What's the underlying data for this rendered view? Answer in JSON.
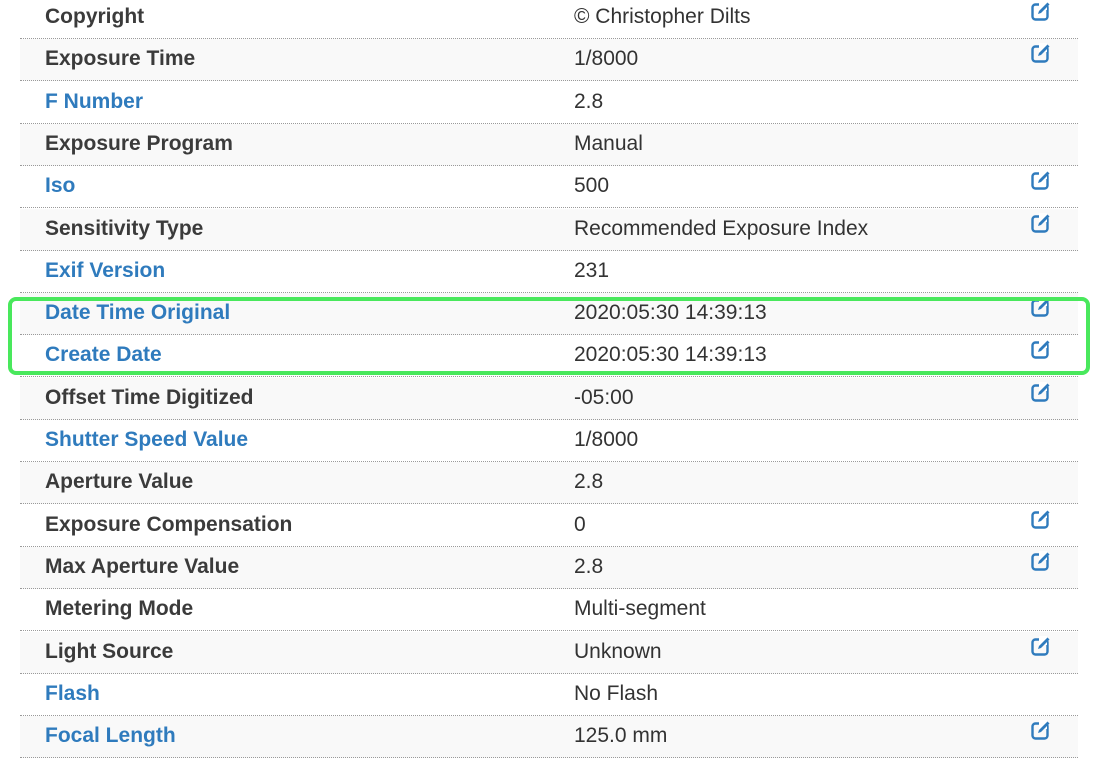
{
  "colors": {
    "link_label": "#2f7bbd",
    "plain_label": "#3b3b3b",
    "value_text": "#333333",
    "edit_icon": "#2f7bbd",
    "highlight_border": "#49e85c"
  },
  "rows": [
    {
      "label": "Copyright",
      "value": "© Christopher Dilts",
      "link": false,
      "editable": true
    },
    {
      "label": "Exposure Time",
      "value": "1/8000",
      "link": false,
      "editable": true
    },
    {
      "label": "F Number",
      "value": "2.8",
      "link": true,
      "editable": false
    },
    {
      "label": "Exposure Program",
      "value": "Manual",
      "link": false,
      "editable": false
    },
    {
      "label": "Iso",
      "value": "500",
      "link": true,
      "editable": true
    },
    {
      "label": "Sensitivity Type",
      "value": "Recommended Exposure Index",
      "link": false,
      "editable": true
    },
    {
      "label": "Exif Version",
      "value": "231",
      "link": true,
      "editable": false
    },
    {
      "label": "Date Time Original",
      "value": "2020:05:30 14:39:13",
      "link": true,
      "editable": true
    },
    {
      "label": "Create Date",
      "value": "2020:05:30 14:39:13",
      "link": true,
      "editable": true
    },
    {
      "label": "Offset Time Digitized",
      "value": "-05:00",
      "link": false,
      "editable": true
    },
    {
      "label": "Shutter Speed Value",
      "value": "1/8000",
      "link": true,
      "editable": false
    },
    {
      "label": "Aperture Value",
      "value": "2.8",
      "link": false,
      "editable": false
    },
    {
      "label": "Exposure Compensation",
      "value": "0",
      "link": false,
      "editable": true
    },
    {
      "label": "Max Aperture Value",
      "value": "2.8",
      "link": false,
      "editable": true
    },
    {
      "label": "Metering Mode",
      "value": "Multi-segment",
      "link": false,
      "editable": false
    },
    {
      "label": "Light Source",
      "value": "Unknown",
      "link": false,
      "editable": true
    },
    {
      "label": "Flash",
      "value": "No Flash",
      "link": true,
      "editable": false
    },
    {
      "label": "Focal Length",
      "value": "125.0 mm",
      "link": true,
      "editable": true
    }
  ]
}
